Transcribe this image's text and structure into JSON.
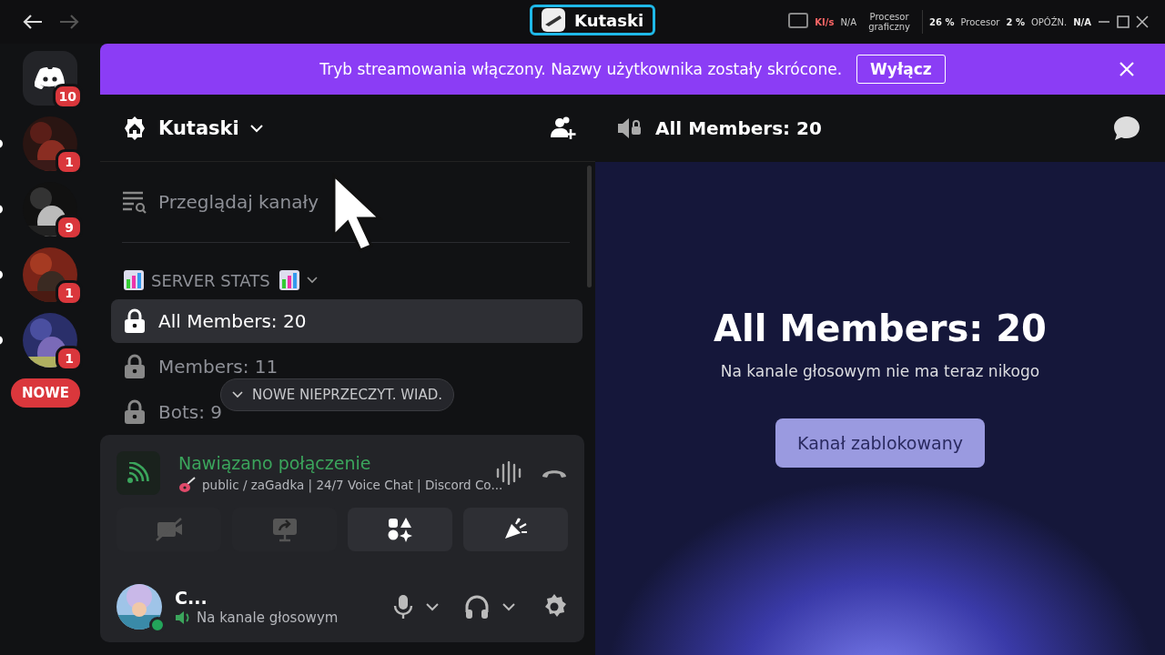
{
  "titlebar": {
    "title": "Kutaski",
    "stats": [
      {
        "value": "KI/s",
        "label": "N/A"
      },
      {
        "value": "Procesor graficzny"
      }
    ],
    "perf": [
      "26 %",
      "Procesor",
      "2 %",
      "OPÓŹN.",
      "N/A"
    ]
  },
  "servers": [
    {
      "kind": "home",
      "badge": "10",
      "unread": false
    },
    {
      "kind": "picture",
      "badge": "1",
      "unread": true
    },
    {
      "kind": "picture",
      "badge": "9",
      "unread": true
    },
    {
      "kind": "picture",
      "badge": "1",
      "unread": true
    },
    {
      "kind": "picture",
      "badge": "1",
      "unread": true
    }
  ],
  "new_pill": "NOWE",
  "banner": {
    "text": "Tryb streamowania włączony. Nazwy użytkownika zostały skrócone.",
    "button": "Wyłącz"
  },
  "server_header": {
    "name": "Kutaski"
  },
  "browse": "Przeglądaj kanały",
  "category": {
    "label": "SERVER STATS",
    "expanded": true
  },
  "channels": [
    {
      "label": "All Members: 20",
      "selected": true
    },
    {
      "label": "Members: 11",
      "selected": false
    },
    {
      "label": "Bots: 9",
      "selected": false
    }
  ],
  "unread_pill": "NOWE NIEPRZECZYT. WIAD.",
  "voice": {
    "status": "Nawiązano połączenie",
    "channel": "public / zaGadka | 24/7 Voice Chat | Discord Co..."
  },
  "user": {
    "name": "C...",
    "status": "Na kanale głosowym",
    "online": true
  },
  "pane": {
    "header": "All Members: 20",
    "title": "All Members: 20",
    "subtitle": "Na kanale głosowym nie ma teraz nikogo",
    "button": "Kanał zablokowany"
  }
}
